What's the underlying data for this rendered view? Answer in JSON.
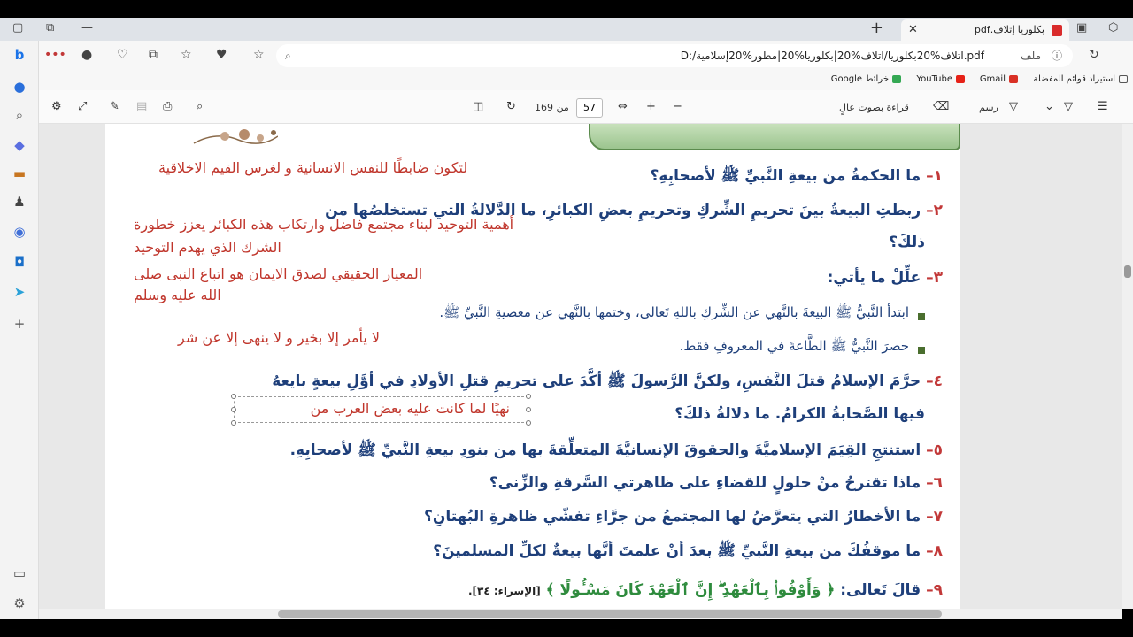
{
  "tab": {
    "title": "بكلوريا إتلاف.pdf",
    "close": "✕"
  },
  "new_tab": "+",
  "address": {
    "file_label": "ملف",
    "url": "D:/اتلاف%20بكلوريا/اتلاف%20|بكلوريا%20|مطور%20إسلامية.pdf"
  },
  "bookmarks": [
    {
      "label": "استيراد قوائم المفضلة"
    },
    {
      "label": "Gmail"
    },
    {
      "label": "YouTube"
    },
    {
      "label": "خرائط Google"
    }
  ],
  "pdf_toolbar": {
    "read_aloud": "قراءة بصوت عالٍ",
    "draw": "رسم",
    "page_current": "57",
    "page_of": "من 169"
  },
  "questions": {
    "q1": {
      "num": "١–",
      "text": "ما الحكمةُ من بيعةِ النَّبيِّ ﷺ لأصحابِهِ؟"
    },
    "a1": "لتكون ضابطًا للنفس الانسانية و لغرس القيم الاخلاقية",
    "q2_line1": {
      "num": "٢–",
      "text": "ربطتِ البيعةُ بينَ تحريمِ الشِّركِ وتحريمِ بعضِ الكبائرِ، ما الدَّلالةُ التي تستخلصُها من"
    },
    "q2_line2": "ذلكَ؟",
    "a2_line1": "أهمية التوحيد لبناء مجتمع فاضل وارتكاب هذه الكبائر يعزز خطورة",
    "a2_line2": "الشرك الذي يهدم التوحيد",
    "q3": {
      "num": "٣–",
      "text": "علِّلْ ما يأتي:"
    },
    "a3_line1": "المعيار الحقيقي لصدق الايمان هو اتباع النبى صلى",
    "a3_line2": "الله عليه وسلم",
    "b1": "ابتدأ النَّبيُّ ﷺ البيعةَ بالنَّهي عن الشِّركِ باللهِ تَعالى، وختمها بالنَّهي عن معصيةِ النَّبيِّ ﷺ.",
    "b2": "حصرَ النَّبيُّ ﷺ الطَّاعةَ في المعروفِ فقط.",
    "a3b": "لا يأمر إلا بخير و لا ينهى إلا عن شر",
    "q4_line1": {
      "num": "٤–",
      "text": "حرَّمَ الإسلامُ قتلَ النَّفسِ، ولكنَّ الرَّسولَ ﷺ أكَّدَ على تحريمِ قتلِ الأولادِ في أوَّلِ بيعةٍ بايعهُ"
    },
    "q4_line2": "فيها الصَّحابةُ الكرامُ. ما دلالةُ ذلكَ؟",
    "a4": "نهيًا لما كانت عليه بعض العرب من",
    "q5": {
      "num": "٥–",
      "text": "استنتجِ القِيَمَ الإسلاميَّةَ والحقوقَ الإنسانيَّةَ المتعلِّقةَ بها من بنودِ بيعةِ النَّبيِّ ﷺ لأصحابِهِ."
    },
    "q6": {
      "num": "٦–",
      "text": "ماذا  تقترحُ منْ حلولٍ للقضاءِ على ظاهرتي السَّرقةِ والزِّنى؟"
    },
    "q7": {
      "num": "٧–",
      "text": "ما الأخطارُ التي يتعرَّضُ لها المجتمعُ من جرَّاءِ تفشّي ظاهرةِ البُهتانِ؟"
    },
    "q8": {
      "num": "٨–",
      "text": "ما موقفُكَ من بيعةِ النَّبيِّ ﷺ بعدَ أنْ علمتَ أنَّها بيعةٌ لكلِّ المسلمينَ؟"
    },
    "q9": {
      "num": "٩–",
      "text": "قالَ تَعالى:",
      "verse": "﴿ وَأَوْفُوا۟ بِٱلْعَهْدِ ۖ إِنَّ ٱلْعَهْدَ كَانَ مَسْـُٔولًا ﴾",
      "ref": "[الإسراء: ٣٤]."
    }
  },
  "colors": {
    "question": "#1e3f7a",
    "answer": "#c0362c",
    "quran": "#2e8b3d"
  }
}
